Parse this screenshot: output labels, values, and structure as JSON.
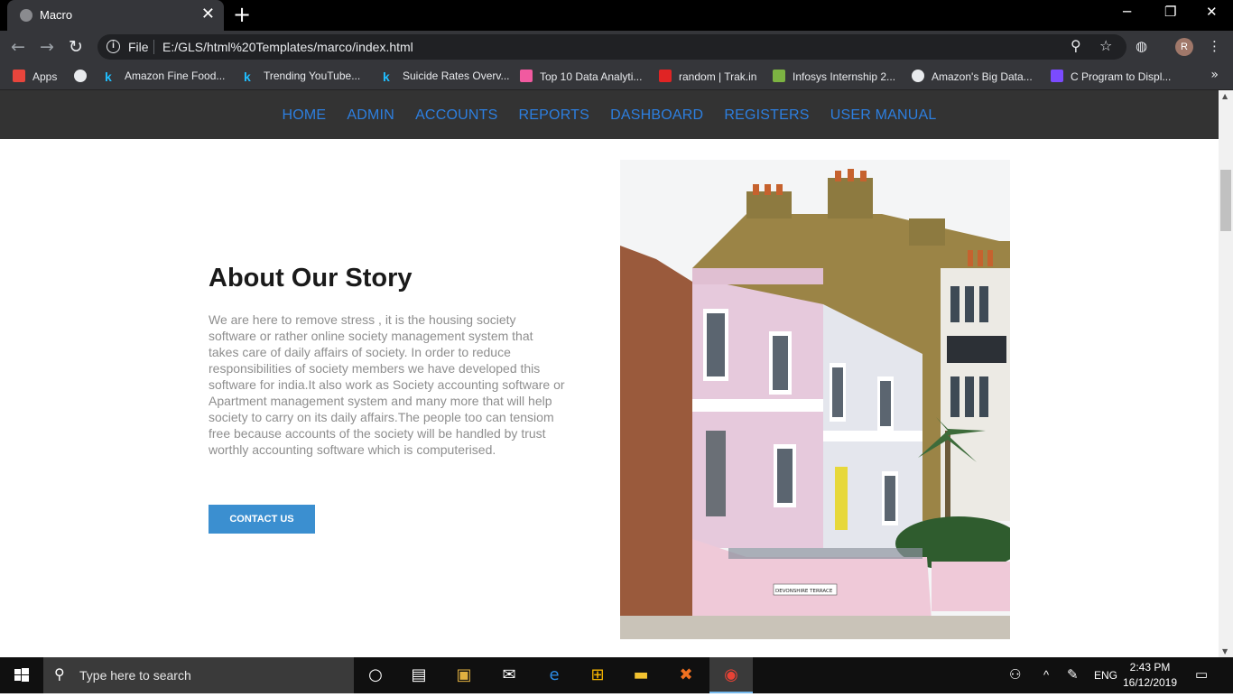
{
  "browser": {
    "tab_title": "Macro",
    "tab_close": "✕",
    "new_tab": "+",
    "url_scheme": "File",
    "url": "E:/GLS/html%20Templates/marco/index.html",
    "profile_initial": "R",
    "window_controls": {
      "minimize": "─",
      "restore": "❐",
      "close": "✕"
    },
    "bookmarks": [
      {
        "label": "Apps",
        "icon": "apps-grid-icon",
        "color": "#e8453c"
      },
      {
        "label": "",
        "icon": "globe-icon",
        "color": "#e8eaed"
      },
      {
        "label": "Amazon Fine Food...",
        "icon": "kaggle-icon",
        "color": "#20beff"
      },
      {
        "label": "Trending YouTube...",
        "icon": "kaggle-icon",
        "color": "#20beff"
      },
      {
        "label": "Suicide Rates Overv...",
        "icon": "kaggle-icon",
        "color": "#20beff"
      },
      {
        "label": "Top 10 Data Analyti...",
        "icon": "analytics-icon",
        "color": "#f15aa0"
      },
      {
        "label": "random | Trak.in",
        "icon": "trakin-icon",
        "color": "#e02424"
      },
      {
        "label": "Infosys Internship 2...",
        "icon": "leaf-icon",
        "color": "#7cb342"
      },
      {
        "label": "Amazon's Big Data...",
        "icon": "globe-icon",
        "color": "#e8eaed"
      },
      {
        "label": "C Program to Displ...",
        "icon": "c-program-icon",
        "color": "#7b4bff"
      }
    ],
    "bookmarks_more": "»"
  },
  "site": {
    "nav": [
      "HOME",
      "ADMIN",
      "ACCOUNTS",
      "REPORTS",
      "DASHBOARD",
      "REGISTERS",
      "USER MANUAL"
    ],
    "about": {
      "heading": "About Our Story",
      "body": "We are here to remove stress , it is the housing society software or rather online society management system that takes care of daily affairs of society. In order to reduce responsibilities of society members we have developed this software for india.It also work as Society accounting software or Apartment management system and many more that will help society to carry on its daily affairs.The people too can tensiom free because accounts of the society will be handled by trust worthly accounting software which is computerised.",
      "button": "CONTACT US"
    },
    "photo_sign": "DEVONSHIRE TERRACE",
    "colors": {
      "nav_bg": "#333333",
      "nav_link": "#2d7fe0",
      "button_bg": "#3b8fd0"
    }
  },
  "taskbar": {
    "search_placeholder": "Type here to search",
    "language": "ENG",
    "time": "2:43 PM",
    "date": "16/12/2019"
  }
}
